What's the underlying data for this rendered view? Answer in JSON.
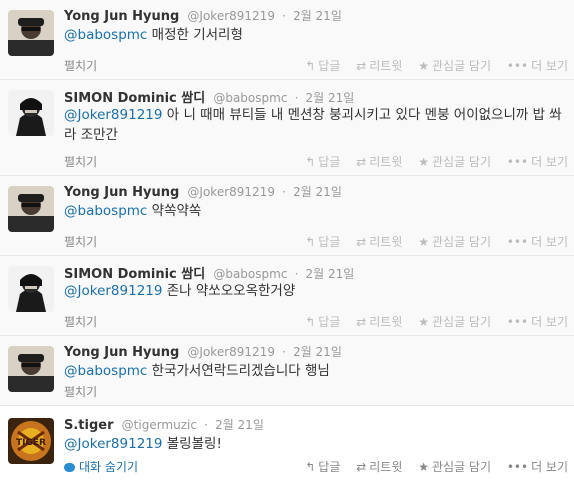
{
  "tweets": [
    {
      "fullname": "Yong Jun Hyung",
      "username": "@Joker891219",
      "time": "2월 21일",
      "mention": "@babospmc",
      "body": " 매정한 기서리형",
      "expand": "펼치기",
      "avatar": "yjh"
    },
    {
      "fullname": "SIMON Dominic 쌈디",
      "username": "@babospmc",
      "time": "2월 21일",
      "mention": "@Joker891219",
      "body": " 아 니 때매 뷰티들 내 멘션창 붕괴시키고 있다 멘붕 어이없으니까 밥 쏴라 조만간",
      "expand": "펼치기",
      "avatar": "simon"
    },
    {
      "fullname": "Yong Jun Hyung",
      "username": "@Joker891219",
      "time": "2월 21일",
      "mention": "@babospmc",
      "body": " 약쏙약쏙",
      "expand": "펼치기",
      "avatar": "yjh"
    },
    {
      "fullname": "SIMON Dominic 쌈디",
      "username": "@babospmc",
      "time": "2월 21일",
      "mention": "@Joker891219",
      "body": " 존나 약쏘오오옥한거양",
      "expand": "펼치기",
      "avatar": "simon"
    },
    {
      "fullname": "Yong Jun Hyung",
      "username": "@Joker891219",
      "time": "2월 21일",
      "mention": "@babospmc",
      "body": " 한국가서연락드리겠습니다 행님",
      "expand": "펼치기",
      "avatar": "yjh"
    },
    {
      "fullname": "S.tiger",
      "username": "@tigermuzic",
      "time": "2월 21일",
      "mention": "@Joker891219",
      "body": " 볼링볼링!",
      "expand": "대화 숨기기",
      "avatar": "tiger"
    }
  ],
  "actions": {
    "reply": "답글",
    "retweet": "리트윗",
    "favorite": "관심글 담기",
    "more": "더 보기"
  },
  "icons": {
    "reply": "reply-icon",
    "retweet": "retweet-icon",
    "favorite": "star-icon",
    "more": "more-icon",
    "conversation": "conversation-icon"
  }
}
